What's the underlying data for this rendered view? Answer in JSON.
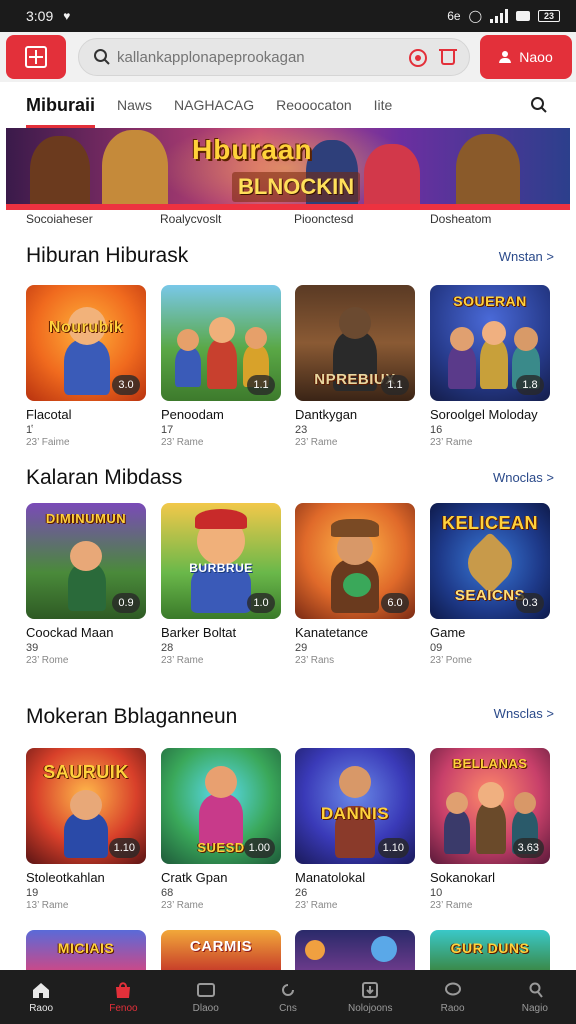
{
  "status_bar": {
    "time": "3:09",
    "right_text": "6e",
    "battery": "23"
  },
  "header": {
    "search_placeholder": "kallankapplonapeprookagan",
    "login_label": "Naoo"
  },
  "tabs": [
    {
      "label": "Miburaii",
      "active": true
    },
    {
      "label": "Naws",
      "active": false
    },
    {
      "label": "NAGHACAG",
      "active": false
    },
    {
      "label": "Reooocaton",
      "active": false
    },
    {
      "label": "Iite",
      "active": false
    }
  ],
  "banner": {
    "title_line1": "Hburaan",
    "title_line2": "BLNOCKIN"
  },
  "banner_captions": [
    "Socoiaheser",
    "Roalycvoslt",
    "Pioonctesd",
    "Dosheatom"
  ],
  "sections": [
    {
      "title": "Hiburan Hiburask",
      "see_all": "Wnstan >",
      "cards": [
        {
          "name": "Flacotal",
          "num": "1̔",
          "meta": "23’ Faime",
          "rating": "3.0",
          "wordmark": "Nourubik"
        },
        {
          "name": "Penoodam",
          "num": "17",
          "meta": "23’ Rame",
          "rating": "1.1",
          "wordmark": ""
        },
        {
          "name": "Dantkygan",
          "num": "23",
          "meta": "23’ Rame",
          "rating": "1.1",
          "wordmark": "NPREBIUX"
        },
        {
          "name": "Soroolgel Moloday",
          "num": "16",
          "meta": "23’ Rame",
          "rating": "1.8",
          "wordmark": "SOUERAN"
        }
      ]
    },
    {
      "title": "Kalaran Mibdass",
      "see_all": "Wnoclas >",
      "cards": [
        {
          "name": "Coockad Maan",
          "num": "39",
          "meta": "23’ Rome",
          "rating": "0.9",
          "wordmark": "DIMINUMUN"
        },
        {
          "name": "Barker Boltat",
          "num": "28",
          "meta": "23’ Rame",
          "rating": "1.0",
          "wordmark": "BURBRUE"
        },
        {
          "name": "Kanatetance",
          "num": "29",
          "meta": "23’ Rans",
          "rating": "6.0",
          "wordmark": ""
        },
        {
          "name": "Game",
          "num": "09",
          "meta": "23’ Pome",
          "rating": "0.3",
          "wordmark": "KELICEAN"
        }
      ]
    },
    {
      "title": "Mokeran Bblaganneun",
      "see_all": "Wnsclas >",
      "cards": [
        {
          "name": "Stoleotkahlan",
          "num": "19",
          "meta": "13’ Rame",
          "rating": "1.10",
          "wordmark": "SAURUIK"
        },
        {
          "name": "Cratk Gpan",
          "num": "68",
          "meta": "23’ Rame",
          "rating": "1.00",
          "wordmark": "SUESD"
        },
        {
          "name": "Manatolokal",
          "num": "26",
          "meta": "23’ Rame",
          "rating": "1.10",
          "wordmark": "DANNIS"
        },
        {
          "name": "Sokanokarl",
          "num": "10",
          "meta": "23’ Rame",
          "rating": "3.63",
          "wordmark": "BELLANAS"
        }
      ]
    }
  ],
  "partial_row": [
    {
      "wordmark": "MICIAIS"
    },
    {
      "wordmark": "CARMIS"
    },
    {
      "wordmark": ""
    },
    {
      "wordmark": "GUR DUNS"
    }
  ],
  "bottom_nav": [
    {
      "label": "Raoo",
      "icon": "home-icon",
      "active": false
    },
    {
      "label": "Fenoo",
      "icon": "shop-icon",
      "active": true
    },
    {
      "label": "Dlaoo",
      "icon": "tv-icon",
      "active": false
    },
    {
      "label": "Cns",
      "icon": "refresh-icon",
      "active": false
    },
    {
      "label": "Nolojoons",
      "icon": "download-icon",
      "active": false
    },
    {
      "label": "Raoo",
      "icon": "chat-icon",
      "active": false
    },
    {
      "label": "Nagio",
      "icon": "profile-icon",
      "active": false
    }
  ],
  "colors": {
    "accent": "#e3303a",
    "link": "#2b4a8a",
    "nav_bg": "#1e1e1e"
  }
}
